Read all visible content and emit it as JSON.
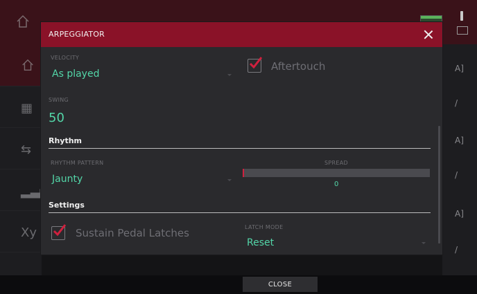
{
  "dialog": {
    "title": "ARPEGGIATOR",
    "velocity": {
      "label": "VELOCITY",
      "value": "As played"
    },
    "aftertouch": {
      "label": "Aftertouch",
      "checked": true
    },
    "swing": {
      "label": "SWING",
      "value": "50"
    },
    "rhythm_section": "Rhythm",
    "rhythm_pattern": {
      "label": "RHYTHM PATTERN",
      "value": "Jaunty"
    },
    "spread": {
      "label": "SPREAD",
      "value": "0",
      "fraction": 0
    },
    "settings_section": "Settings",
    "sustain": {
      "label": "Sustain Pedal Latches",
      "checked": true
    },
    "latch_mode": {
      "label": "LATCH MODE",
      "value": "Reset"
    }
  },
  "footer": {
    "close_label": "CLOSE"
  },
  "colors": {
    "accent": "#8a1228",
    "value_text": "#53d6a8",
    "check": "#d0203e"
  },
  "icons": [
    "home-icon",
    "close-icon",
    "checkmark-icon",
    "warning-icon",
    "monitor-icon"
  ]
}
